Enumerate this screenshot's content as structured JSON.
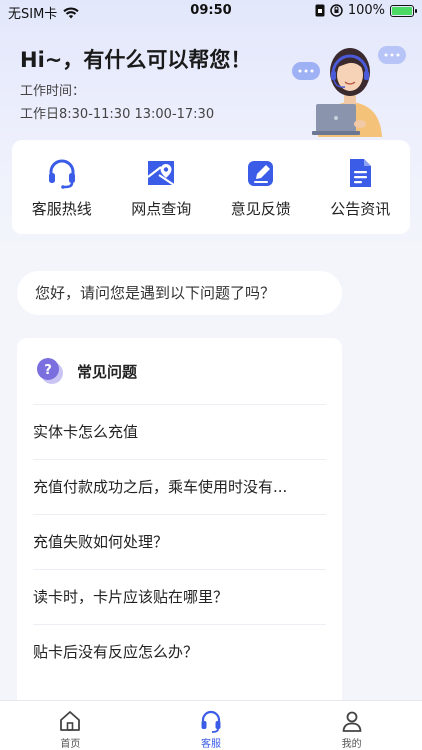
{
  "status_bar": {
    "carrier": "无SIM卡",
    "time": "09:50",
    "battery": "100%"
  },
  "header": {
    "greeting": "Hi~，有什么可以帮您！",
    "work_time_label": "工作时间：",
    "work_time_value": "工作日8:30-11:30 13:00-17:30"
  },
  "quick_menu": [
    {
      "label": "客服热线",
      "icon": "headset-icon"
    },
    {
      "label": "网点查询",
      "icon": "map-pin-icon"
    },
    {
      "label": "意见反馈",
      "icon": "edit-icon"
    },
    {
      "label": "公告资讯",
      "icon": "document-icon"
    }
  ],
  "chat": {
    "prompt": "您好，请问您是遇到以下问题了吗？"
  },
  "faq": {
    "title": "常见问题",
    "items": [
      "实体卡怎么充值",
      "充值付款成功之后，乘车使用时没有...",
      "充值失败如何处理？",
      "读卡时，卡片应该贴在哪里？",
      "贴卡后没有反应怎么办？"
    ]
  },
  "tab_bar": {
    "tabs": [
      {
        "label": "首页",
        "icon": "home-icon"
      },
      {
        "label": "客服",
        "icon": "headset-icon"
      },
      {
        "label": "我的",
        "icon": "user-icon"
      }
    ],
    "active": "客服"
  },
  "colors": {
    "accent": "#3b5ce6",
    "background": "#f3f5fb"
  }
}
